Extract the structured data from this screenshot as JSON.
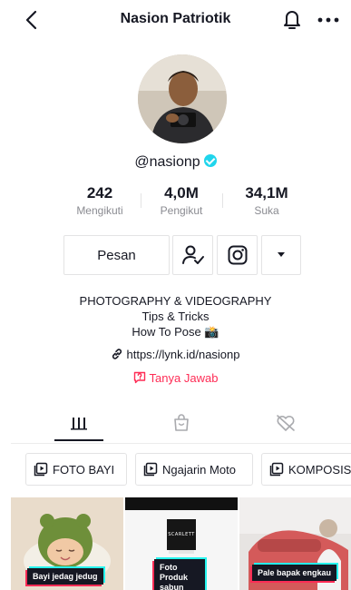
{
  "header": {
    "title": "Nasion Patriotik"
  },
  "profile": {
    "username": "@nasionp"
  },
  "stats": [
    {
      "value": "242",
      "label": "Mengikuti"
    },
    {
      "value": "4,0M",
      "label": "Pengikut"
    },
    {
      "value": "34,1M",
      "label": "Suka"
    }
  ],
  "actions": {
    "message_label": "Pesan"
  },
  "bio": {
    "line1": "PHOTOGRAPHY & VIDEOGRAPHY",
    "line2": "Tips & Tricks",
    "line3": "How To Pose",
    "line3_emoji": "📸",
    "link": "https://lynk.id/nasionp",
    "qa_label": "Tanya Jawab"
  },
  "playlists": [
    {
      "label": "FOTO BAYI"
    },
    {
      "label": "Ngajarin Moto"
    },
    {
      "label": "KOMPOSIS"
    }
  ],
  "videos": [
    {
      "caption": "Bayi jedag jedug"
    },
    {
      "caption": "Foto Produk sabun",
      "product_text": "SCARLETT"
    },
    {
      "caption": "Pale bapak engkau"
    }
  ],
  "colors": {
    "accent": "#fe2c55",
    "verified": "#20d5ec",
    "muted": "#8a8b91",
    "text": "#161823"
  }
}
